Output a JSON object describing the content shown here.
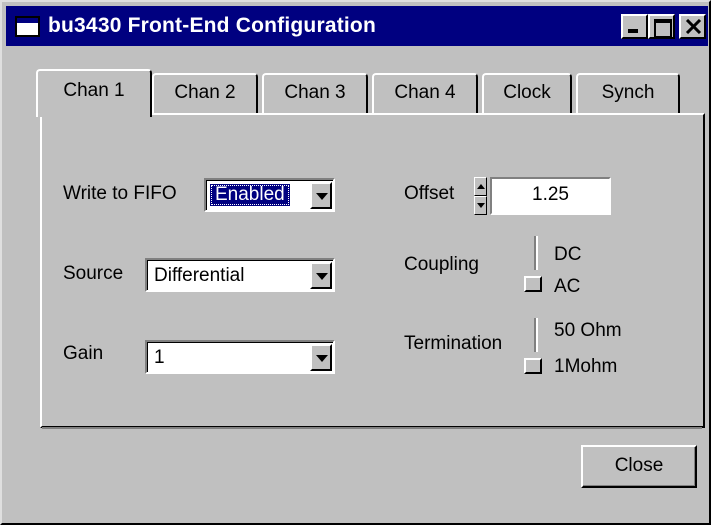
{
  "window": {
    "title": "bu3430 Front-End Configuration"
  },
  "tabs": [
    {
      "label": "Chan 1",
      "active": true
    },
    {
      "label": "Chan 2",
      "active": false
    },
    {
      "label": "Chan 3",
      "active": false
    },
    {
      "label": "Chan 4",
      "active": false
    },
    {
      "label": "Clock",
      "active": false
    },
    {
      "label": "Synch",
      "active": false
    }
  ],
  "channel": {
    "write_fifo": {
      "label": "Write to FIFO",
      "value": "Enabled"
    },
    "source": {
      "label": "Source",
      "value": "Differential"
    },
    "gain": {
      "label": "Gain",
      "value": "1"
    },
    "offset": {
      "label": "Offset",
      "value": "1.25"
    },
    "coupling": {
      "label": "Coupling",
      "options": [
        "DC",
        "AC"
      ],
      "selected": "AC"
    },
    "termination": {
      "label": "Termination",
      "options": [
        "50 Ohm",
        "1Mohm"
      ],
      "selected": "1Mohm"
    }
  },
  "buttons": {
    "close": "Close"
  }
}
